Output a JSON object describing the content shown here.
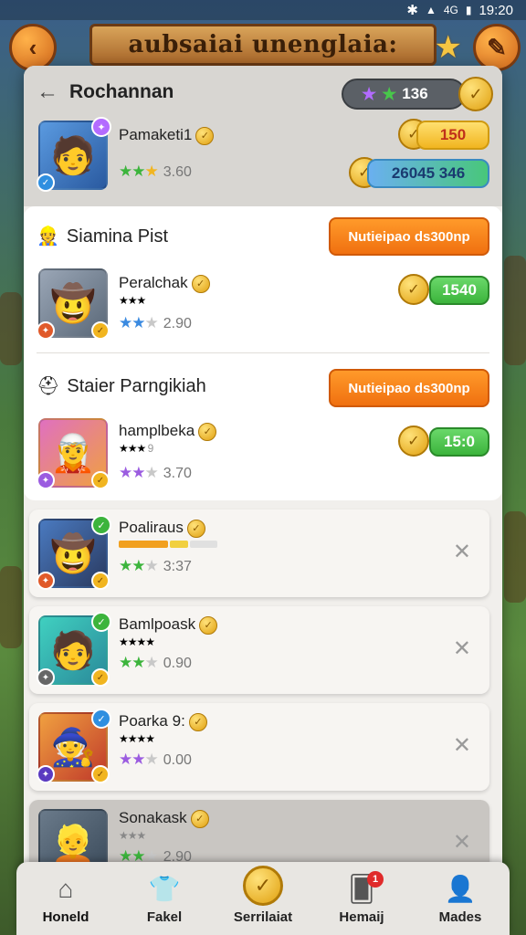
{
  "status_bar": {
    "time": "19:20",
    "network": "4G"
  },
  "banner": {
    "title": "aubsaiai unenglaia:",
    "back_icon": "chevron-left",
    "tool_icon": "wrench"
  },
  "header": {
    "title": "Rochannan",
    "stars_value": "136"
  },
  "profile": {
    "name": "Pamaketi1",
    "rating": "3.60",
    "coins": "150",
    "balance": "26045 346"
  },
  "sections": [
    {
      "title": "Siamina Pist",
      "action": "Nutieipao ds300np",
      "player": {
        "name": "Peralchak",
        "rating": "2.90",
        "price": "1540"
      }
    },
    {
      "title": "Staier Parngikiah",
      "action": "Nutieipao ds300np",
      "player": {
        "name": "hamplbeka",
        "rating": "3.70",
        "price": "15:0",
        "sub": "9"
      }
    }
  ],
  "cards": [
    {
      "name": "Poaliraus",
      "rating": "3:37"
    },
    {
      "name": "Bamlpoask",
      "rating": "0.90"
    },
    {
      "name": "Poarka",
      "rating": "0.00",
      "suffix": "9:"
    },
    {
      "name": "Sonakask",
      "rating": "2.90"
    }
  ],
  "nav": [
    {
      "label": "Honeld",
      "icon": "home-icon"
    },
    {
      "label": "Fakel",
      "icon": "shirt-icon"
    },
    {
      "label": "Serrilaiat",
      "icon": "coin-icon"
    },
    {
      "label": "Hemaij",
      "icon": "cards-icon",
      "badge": "1"
    },
    {
      "label": "Mades",
      "icon": "person-icon"
    }
  ],
  "colors": {
    "accent_orange": "#f07010",
    "coin_gold": "#e0a010",
    "price_green": "#3cb43c"
  }
}
